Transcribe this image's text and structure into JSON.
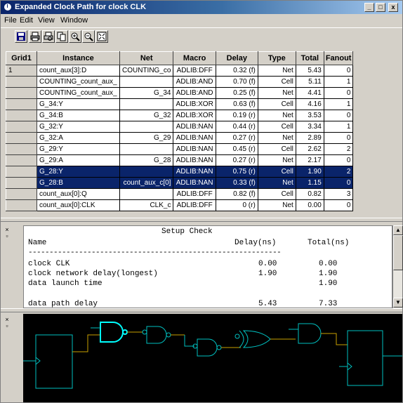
{
  "window": {
    "title": "Expanded Clock Path for clock CLK",
    "controls": {
      "minimize": "_",
      "maximize": "□",
      "close": "x"
    }
  },
  "menu": {
    "items": [
      "File",
      "Edit",
      "View",
      "Window"
    ]
  },
  "toolbar": {
    "buttons": [
      "save-icon",
      "print-icon",
      "print-preview-icon",
      "copy-icon",
      "zoom-in-icon",
      "zoom-out-icon",
      "zoom-fit-icon"
    ]
  },
  "grid": {
    "columns": [
      "Grid1",
      "Instance",
      "Net",
      "Macro",
      "Delay",
      "Type",
      "Total",
      "Fanout"
    ],
    "rows": [
      [
        "1",
        "count_aux[3]:D",
        "COUNTING_co",
        "ADLIB:DFF",
        "0.32 (f)",
        "Net",
        "5.43",
        "0"
      ],
      [
        "",
        "COUNTING_count_aux_",
        "",
        "ADLIB:AND",
        "0.70 (f)",
        "Cell",
        "5.11",
        "1"
      ],
      [
        "",
        "COUNTING_count_aux_",
        "G_34",
        "ADLIB:AND",
        "0.25 (f)",
        "Net",
        "4.41",
        "0"
      ],
      [
        "",
        "G_34:Y",
        "",
        "ADLIB:XOR",
        "0.63 (f)",
        "Cell",
        "4.16",
        "1"
      ],
      [
        "",
        "G_34:B",
        "G_32",
        "ADLIB:XOR",
        "0.19 (r)",
        "Net",
        "3.53",
        "0"
      ],
      [
        "",
        "G_32:Y",
        "",
        "ADLIB:NAN",
        "0.44 (r)",
        "Cell",
        "3.34",
        "1"
      ],
      [
        "",
        "G_32:A",
        "G_29",
        "ADLIB:NAN",
        "0.27 (r)",
        "Net",
        "2.89",
        "0"
      ],
      [
        "",
        "G_29:Y",
        "",
        "ADLIB:NAN",
        "0.45 (r)",
        "Cell",
        "2.62",
        "2"
      ],
      [
        "",
        "G_29:A",
        "G_28",
        "ADLIB:NAN",
        "0.27 (r)",
        "Net",
        "2.17",
        "0"
      ],
      [
        "",
        "G_28:Y",
        "",
        "ADLIB:NAN",
        "0.75 (r)",
        "Cell",
        "1.90",
        "2"
      ],
      [
        "",
        "G_28:B",
        "count_aux_c[0]",
        "ADLIB:NAN",
        "0.33 (f)",
        "Net",
        "1.15",
        "0"
      ],
      [
        "",
        "count_aux[0]:Q",
        "",
        "ADLIB:DFF",
        "0.82 (f)",
        "Cell",
        "0.82",
        "3"
      ],
      [
        "",
        "count_aux[0]:CLK",
        "CLK_c",
        "ADLIB:DFF",
        "0 (r)",
        "Net",
        "0.00",
        "0"
      ]
    ],
    "selected_rows": [
      9,
      10
    ]
  },
  "report": {
    "heading": "Setup Check",
    "col_name": "Name",
    "col_delay": "Delay(ns)",
    "col_total": "Total(ns)",
    "separator": "------------------------------------------------------------",
    "lines": [
      {
        "name": "clock CLK",
        "delay": "0.00",
        "total": "0.00"
      },
      {
        "name": "clock network delay(longest)",
        "delay": "1.90",
        "total": "1.90"
      },
      {
        "name": "data launch time",
        "delay": "",
        "total": "1.90"
      },
      {
        "name": "data path delay",
        "delay": "5.43",
        "total": "7.33"
      }
    ]
  },
  "colors": {
    "selection": "#0a246a",
    "schematic_bg": "#000000",
    "wire": "#00c0c0",
    "highlight_wire": "#c8a000",
    "highlight_gate": "#00ffff"
  }
}
